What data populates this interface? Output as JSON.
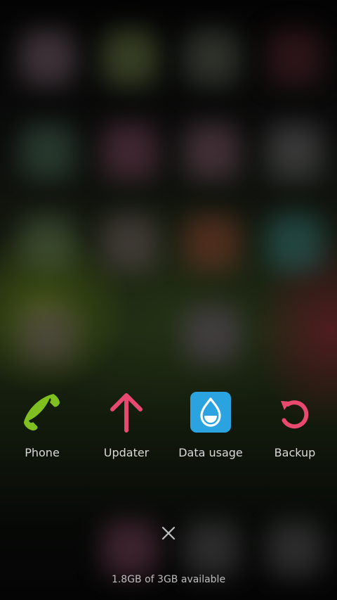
{
  "recent_apps": [
    {
      "label": "Phone",
      "icon": "phone-icon",
      "color": "#7fbf1f"
    },
    {
      "label": "Updater",
      "icon": "arrow-up-icon",
      "color": "#e8496f"
    },
    {
      "label": "Data usage",
      "icon": "water-drop-icon",
      "color": "#2aa3e0"
    },
    {
      "label": "Backup",
      "icon": "backup-restore-icon",
      "color": "#e8496f"
    }
  ],
  "close_icon": "close-icon",
  "memory_text": "1.8GB of 3GB available"
}
